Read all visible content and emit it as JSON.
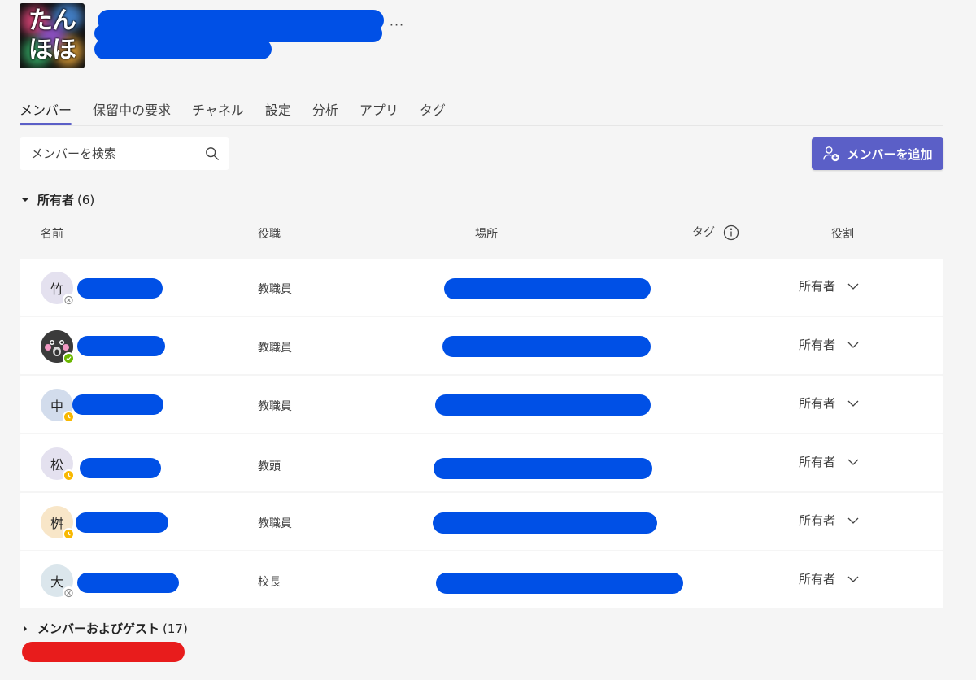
{
  "team": {
    "logo_line1": "たん",
    "logo_line2": "ほほ",
    "more_label": "···"
  },
  "tabs": [
    {
      "label": "メンバー",
      "active": true
    },
    {
      "label": "保留中の要求"
    },
    {
      "label": "チャネル"
    },
    {
      "label": "設定"
    },
    {
      "label": "分析"
    },
    {
      "label": "アプリ"
    },
    {
      "label": "タグ"
    }
  ],
  "search": {
    "placeholder": "メンバーを検索"
  },
  "add_button": {
    "label": "メンバーを追加"
  },
  "owners_section": {
    "title": "所有者",
    "count": "(6)"
  },
  "columns": {
    "name": "名前",
    "title": "役職",
    "location": "場所",
    "tags": "タグ",
    "role": "役割"
  },
  "rows": [
    {
      "initial": "竹",
      "job_title": "教職員",
      "role": "所有者",
      "avatar_color": "#e4e1ef",
      "presence": "offline"
    },
    {
      "initial": "",
      "job_title": "教職員",
      "role": "所有者",
      "avatar_color": "#3b3b3b",
      "presence": "available"
    },
    {
      "initial": "中",
      "job_title": "教職員",
      "role": "所有者",
      "avatar_color": "#d2dcec",
      "presence": "away"
    },
    {
      "initial": "松",
      "job_title": "教頭",
      "role": "所有者",
      "avatar_color": "#e4e1ef",
      "presence": "away"
    },
    {
      "initial": "桝",
      "job_title": "教職員",
      "role": "所有者",
      "avatar_color": "#f8e6c8",
      "presence": "away"
    },
    {
      "initial": "大",
      "job_title": "校長",
      "role": "所有者",
      "avatar_color": "#dbe6ec",
      "presence": "offline"
    }
  ],
  "members_section": {
    "title": "メンバーおよびゲスト",
    "count": "(17)"
  },
  "colors": {
    "accent": "#5b5fc7",
    "redaction_blue": "#0050e6",
    "redaction_red": "#e81c1c",
    "presence_available": "#6bb700",
    "presence_away": "#f8b800",
    "presence_offline": "#8a8a8a"
  }
}
